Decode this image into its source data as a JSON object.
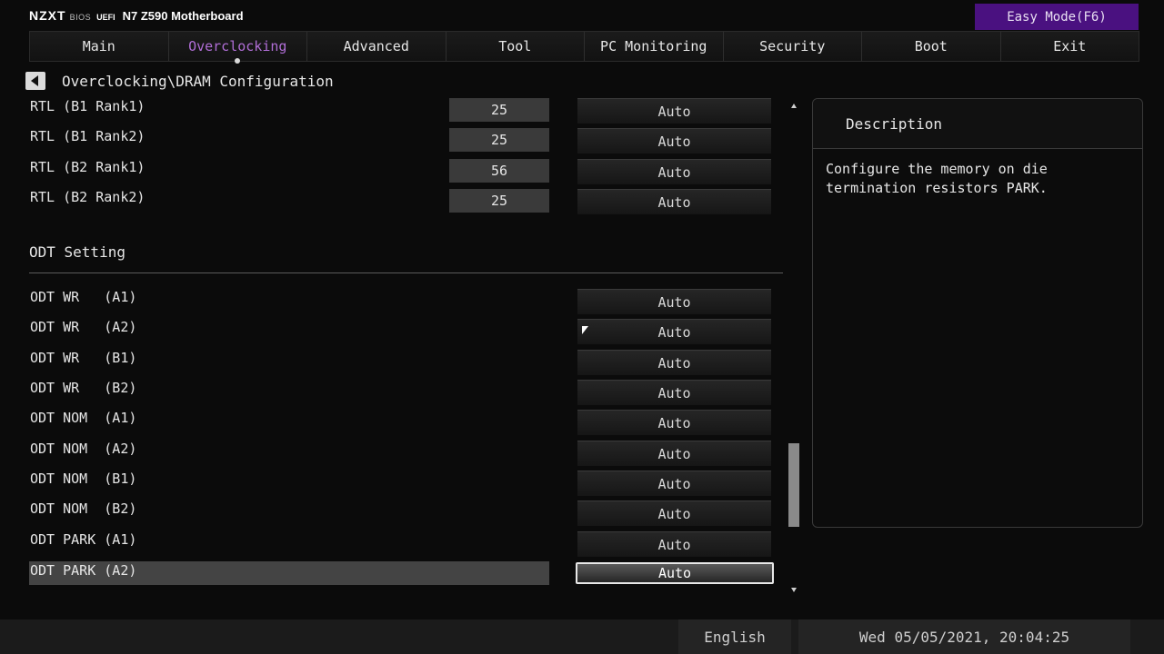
{
  "header": {
    "logo": "NZXT",
    "bios_label": "BIOS",
    "uefi_label": "UEFI",
    "model": "N7 Z590 Motherboard",
    "easy_mode": "Easy Mode(F6)"
  },
  "tabs": [
    {
      "label": "Main"
    },
    {
      "label": "Overclocking",
      "active": true
    },
    {
      "label": "Advanced"
    },
    {
      "label": "Tool"
    },
    {
      "label": "PC Monitoring"
    },
    {
      "label": "Security"
    },
    {
      "label": "Boot"
    },
    {
      "label": "Exit"
    }
  ],
  "breadcrumb": "Overclocking\\DRAM Configuration",
  "rtl_rows": [
    {
      "label": "RTL (B1 Rank1)",
      "value": "25",
      "setting": "Auto"
    },
    {
      "label": "RTL (B1 Rank2)",
      "value": "25",
      "setting": "Auto"
    },
    {
      "label": "RTL (B2 Rank1)",
      "value": "56",
      "setting": "Auto"
    },
    {
      "label": "RTL (B2 Rank2)",
      "value": "25",
      "setting": "Auto"
    }
  ],
  "section_title": "ODT Setting",
  "odt_rows": [
    {
      "label": "ODT WR   (A1)",
      "setting": "Auto"
    },
    {
      "label": "ODT WR   (A2)",
      "setting": "Auto"
    },
    {
      "label": "ODT WR   (B1)",
      "setting": "Auto"
    },
    {
      "label": "ODT WR   (B2)",
      "setting": "Auto"
    },
    {
      "label": "ODT NOM  (A1)",
      "setting": "Auto"
    },
    {
      "label": "ODT NOM  (A2)",
      "setting": "Auto"
    },
    {
      "label": "ODT NOM  (B1)",
      "setting": "Auto"
    },
    {
      "label": "ODT NOM  (B2)",
      "setting": "Auto"
    },
    {
      "label": "ODT PARK (A1)",
      "setting": "Auto"
    },
    {
      "label": "ODT PARK (A2)",
      "setting": "Auto",
      "selected": true
    }
  ],
  "description": {
    "title": "Description",
    "text": "Configure the memory on die termination resistors PARK."
  },
  "footer": {
    "language": "English",
    "datetime": "Wed 05/05/2021, 20:04:25"
  },
  "colors": {
    "accent": "#b06ed6",
    "easy_mode_bg": "#4a1180",
    "selection": "#444444"
  }
}
